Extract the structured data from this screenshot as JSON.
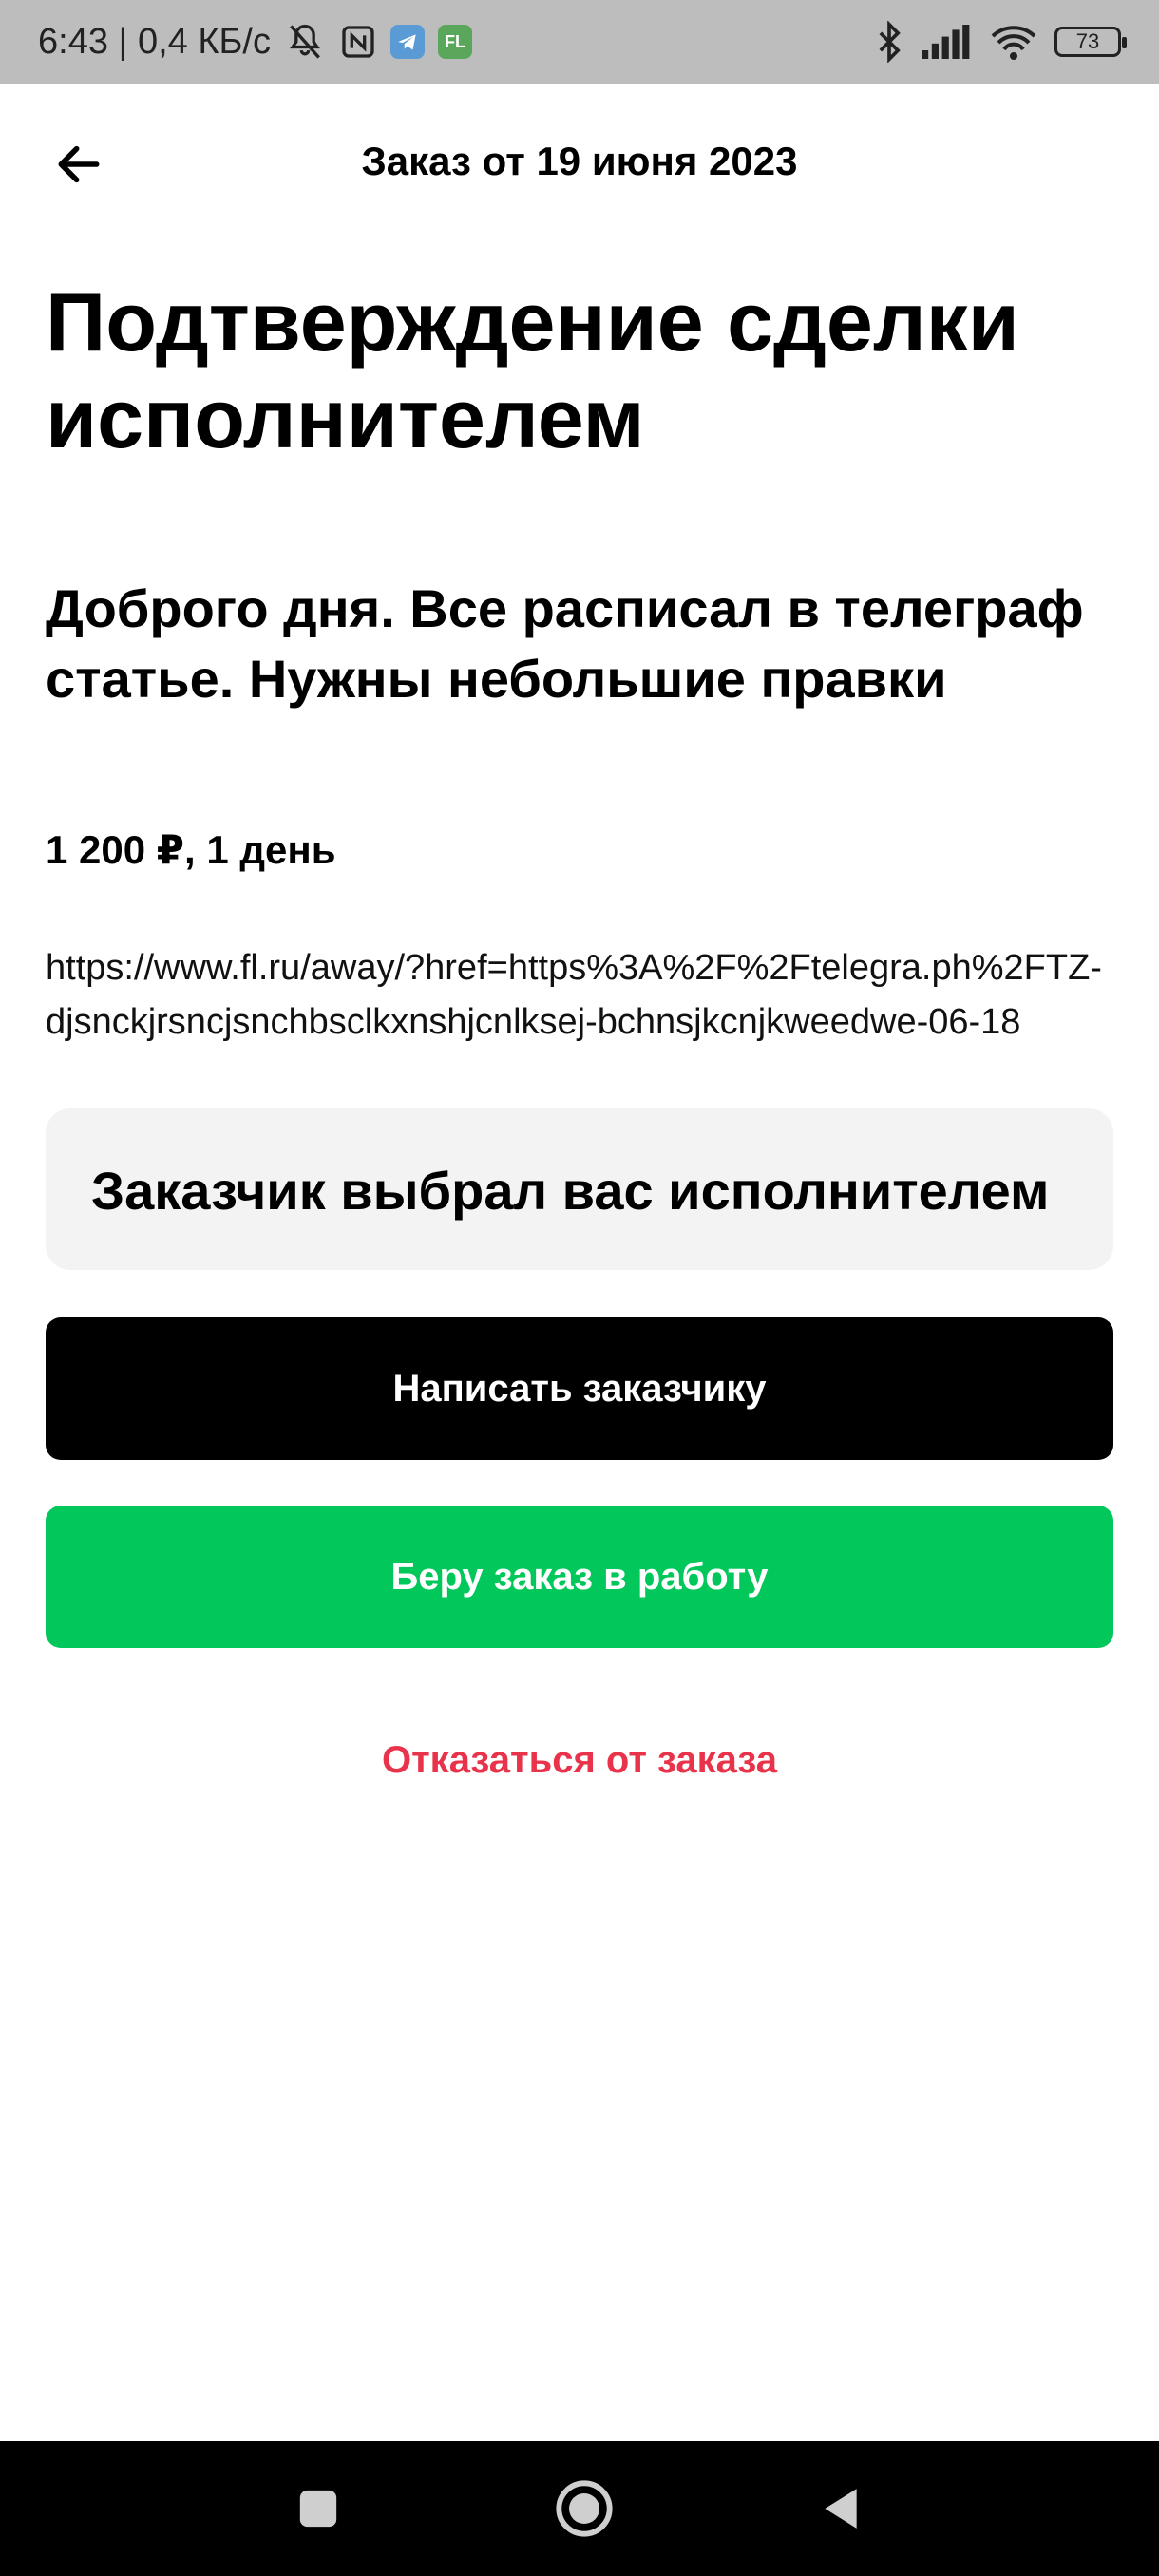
{
  "status_bar": {
    "time_speed": "6:43 | 0,4 КБ/с",
    "battery": "73",
    "app_icon_fl": "FL"
  },
  "header": {
    "title": "Заказ от 19 июня 2023"
  },
  "main": {
    "page_title": "Подтверждение сделки исполнителем",
    "order_description": "Доброго дня. Все расписал в телеграф статье. Нужны небольшие правки",
    "price_line": "1 200 ₽, 1 день",
    "link": "https://www.fl.ru/away/?href=https%3A%2F%2Ftelegra.ph%2FTZ-djsnckjrsncjsnchbsclkxnshjcnlksej-bchnsjkcnjkweedwe-06-18",
    "notice": "Заказчик выбрал вас исполнителем",
    "message_button": "Написать заказчику",
    "accept_button": "Беру заказ в работу",
    "decline_link": "Отказаться от заказа"
  },
  "colors": {
    "accent_green": "#02c75a",
    "decline_red": "#e8334a",
    "primary_black": "#000000"
  }
}
